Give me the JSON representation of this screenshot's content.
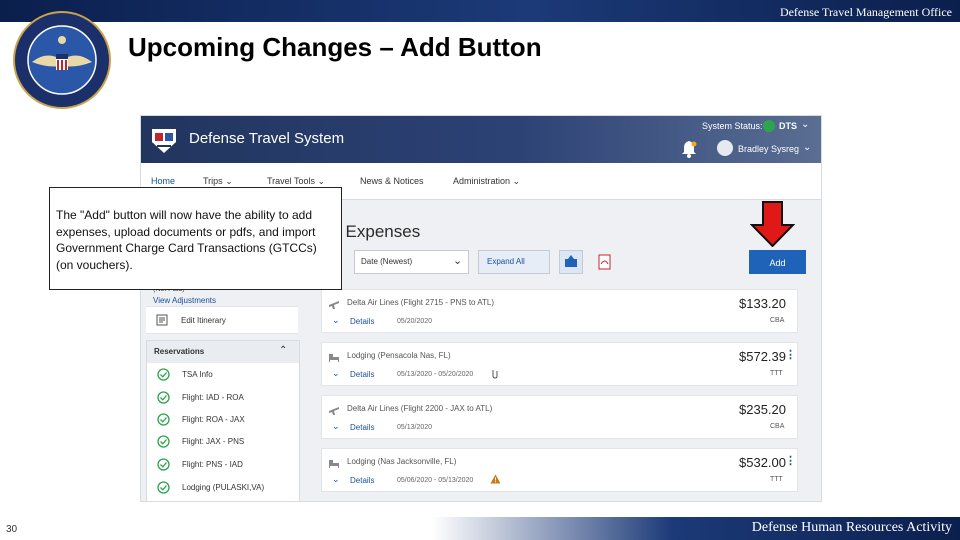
{
  "slide": {
    "office": "Defense Travel Management Office",
    "title": "Upcoming Changes – Add Button",
    "page_number": "30",
    "footer": "Defense Human Resources Activity",
    "seal_icon": "dod-seal-icon"
  },
  "app": {
    "name": "Defense Travel System",
    "system_status_label": "System Status:",
    "system_status_value": "DTS",
    "user_name": "Bradley Sysreg",
    "nav": [
      "Home",
      "Trips",
      "Travel Tools",
      "News & Notices",
      "Administration"
    ],
    "page_heading": "ter Expenses",
    "sort_value": "Date (Newest)",
    "expand_all_label": "Expand All",
    "add_label": "Add",
    "accent_color": "#1f63b8",
    "header_color": "#21355e"
  },
  "sidebar": {
    "truncated_text": "(Not Paid)",
    "view_adjustments": "View Adjustments",
    "edit_itinerary": "Edit Itinerary",
    "reservations_title": "Reservations",
    "reservations": [
      {
        "label": "TSA Info",
        "icon": "check-icon"
      },
      {
        "label": "Flight: IAD - ROA",
        "icon": "check-icon"
      },
      {
        "label": "Flight: ROA - JAX",
        "icon": "check-icon"
      },
      {
        "label": "Flight: JAX - PNS",
        "icon": "check-icon"
      },
      {
        "label": "Flight: PNS - IAD",
        "icon": "check-icon"
      },
      {
        "label": "Lodging (PULASKI,VA)",
        "icon": "check-icon"
      }
    ]
  },
  "expenses": [
    {
      "title": "Delta Air Lines (Flight 2715 - PNS to ATL)",
      "details": "Details",
      "date": "05/20/2020",
      "amount": "$133.20",
      "code": "CBA",
      "icon": "plane-icon"
    },
    {
      "title": "Lodging (Pensacola Nas, FL)",
      "details": "Details",
      "date": "05/13/2020 - 05/20/2020",
      "amount": "$572.39",
      "code": "TTT",
      "icon": "bed-icon"
    },
    {
      "title": "Delta Air Lines (Flight 2200 - JAX to ATL)",
      "details": "Details",
      "date": "05/13/2020",
      "amount": "$235.20",
      "code": "CBA",
      "icon": "plane-icon"
    },
    {
      "title": "Lodging (Nas Jacksonville, FL)",
      "details": "Details",
      "date": "05/06/2020 - 05/13/2020",
      "amount": "$532.00",
      "code": "TTT",
      "icon": "bed-icon"
    }
  ],
  "callout": {
    "text": "The \"Add\" button will now have the ability to add expenses, upload documents or pdfs, and import Government Charge Card Transactions (GTCCs) (on vouchers)."
  },
  "arrow": {
    "color": "#e01818",
    "icon": "red-down-arrow-icon"
  }
}
